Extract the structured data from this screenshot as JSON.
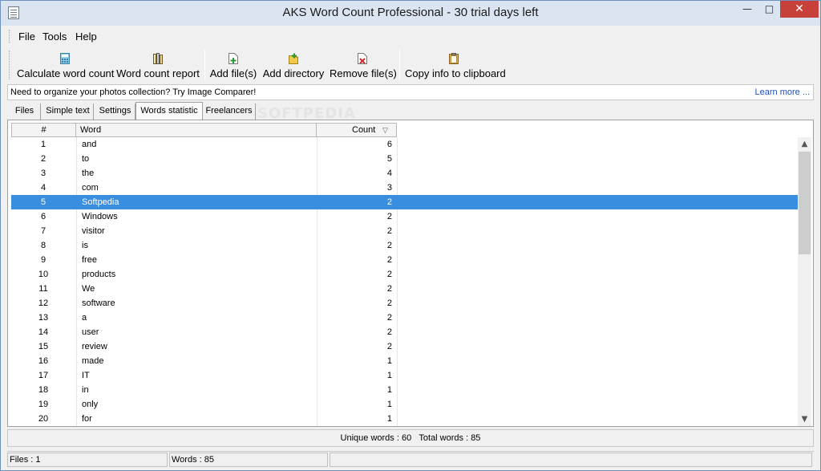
{
  "window": {
    "title": "AKS Word Count Professional - 30 trial days left"
  },
  "menu": {
    "file": "File",
    "tools": "Tools",
    "help": "Help"
  },
  "toolbar": {
    "calculate": "Calculate word count",
    "report": "Word count report",
    "add_files": "Add file(s)",
    "add_directory": "Add directory",
    "remove_files": "Remove file(s)",
    "copy_info": "Copy info to clipboard"
  },
  "ad": {
    "text": "Need to organize your photos collection? Try Image Comparer!",
    "link": "Learn more ..."
  },
  "tabs": [
    "Files",
    "Simple text",
    "Settings",
    "Words statistic",
    "Freelancers"
  ],
  "watermark": "SOFTPEDIA",
  "table": {
    "headers": {
      "num": "#",
      "word": "Word",
      "count": "Count",
      "sort_glyph": "▽"
    },
    "rows": [
      {
        "num": "1",
        "word": "and",
        "count": "6"
      },
      {
        "num": "2",
        "word": "to",
        "count": "5"
      },
      {
        "num": "3",
        "word": "the",
        "count": "4"
      },
      {
        "num": "4",
        "word": "com",
        "count": "3"
      },
      {
        "num": "5",
        "word": "Softpedia",
        "count": "2"
      },
      {
        "num": "6",
        "word": "Windows",
        "count": "2"
      },
      {
        "num": "7",
        "word": "visitor",
        "count": "2"
      },
      {
        "num": "8",
        "word": "is",
        "count": "2"
      },
      {
        "num": "9",
        "word": "free",
        "count": "2"
      },
      {
        "num": "10",
        "word": "products",
        "count": "2"
      },
      {
        "num": "11",
        "word": "We",
        "count": "2"
      },
      {
        "num": "12",
        "word": "software",
        "count": "2"
      },
      {
        "num": "13",
        "word": "a",
        "count": "2"
      },
      {
        "num": "14",
        "word": "user",
        "count": "2"
      },
      {
        "num": "15",
        "word": "review",
        "count": "2"
      },
      {
        "num": "16",
        "word": "made",
        "count": "1"
      },
      {
        "num": "17",
        "word": "IT",
        "count": "1"
      },
      {
        "num": "18",
        "word": "in",
        "count": "1"
      },
      {
        "num": "19",
        "word": "only",
        "count": "1"
      },
      {
        "num": "20",
        "word": "for",
        "count": "1"
      }
    ],
    "selected_row": 4
  },
  "summary": {
    "unique": "Unique words : 60",
    "total": "Total words : 85"
  },
  "status": {
    "files": "Files : 1",
    "words": "Words : 85"
  },
  "colors": {
    "selection": "#3a8ee0",
    "close_button": "#c7413a",
    "link": "#1f4fb0"
  }
}
